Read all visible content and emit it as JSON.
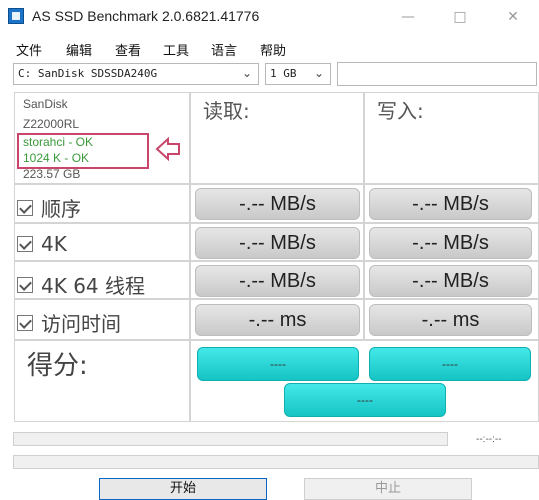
{
  "window": {
    "title": "AS SSD Benchmark 2.0.6821.41776",
    "minimize_glyph": "—",
    "maximize_glyph": "□",
    "close_glyph": "✕"
  },
  "menu": [
    "文件",
    "编辑",
    "查看",
    "工具",
    "语言",
    "帮助"
  ],
  "drive_select": {
    "value": "C: SanDisk SDSSDA240G"
  },
  "size_select": {
    "value": "1 GB"
  },
  "extra_input": {
    "value": ""
  },
  "drive_info": {
    "vendor": "SanDisk",
    "firmware": "Z22000RL",
    "driver_status": "storahci - OK",
    "alignment_status": "1024 K - OK",
    "capacity": "223.57 GB"
  },
  "columns": {
    "read": "读取:",
    "write": "写入:"
  },
  "rows": [
    {
      "label": "顺序",
      "read": "-.-- MB/s",
      "write": "-.-- MB/s",
      "checked": true
    },
    {
      "label": "4K",
      "read": "-.-- MB/s",
      "write": "-.-- MB/s",
      "checked": true
    },
    {
      "label": "4K 64 线程",
      "read": "-.-- MB/s",
      "write": "-.-- MB/s",
      "checked": true
    },
    {
      "label": "访问时间",
      "read": "-.-- ms",
      "write": "-.-- ms",
      "checked": true
    }
  ],
  "score": {
    "label": "得分:",
    "read": "----",
    "write": "----",
    "total": "----"
  },
  "progress": {
    "main_fraction": 0,
    "secondary_fraction": 0,
    "elapsed": "--:--:--"
  },
  "buttons": {
    "start": "开始",
    "stop": "中止"
  },
  "colors": {
    "score_accent": "#20d0d0",
    "ok_text": "#3a9a3a",
    "annotation_red": "#c9466a",
    "start_border": "#0a66c2"
  },
  "icons": {
    "app": "as-ssd-app-icon",
    "checkbox": "checkbox-checked-icon",
    "arrow": "left-arrow-annotation-icon",
    "chevron": "chevron-down-icon"
  }
}
